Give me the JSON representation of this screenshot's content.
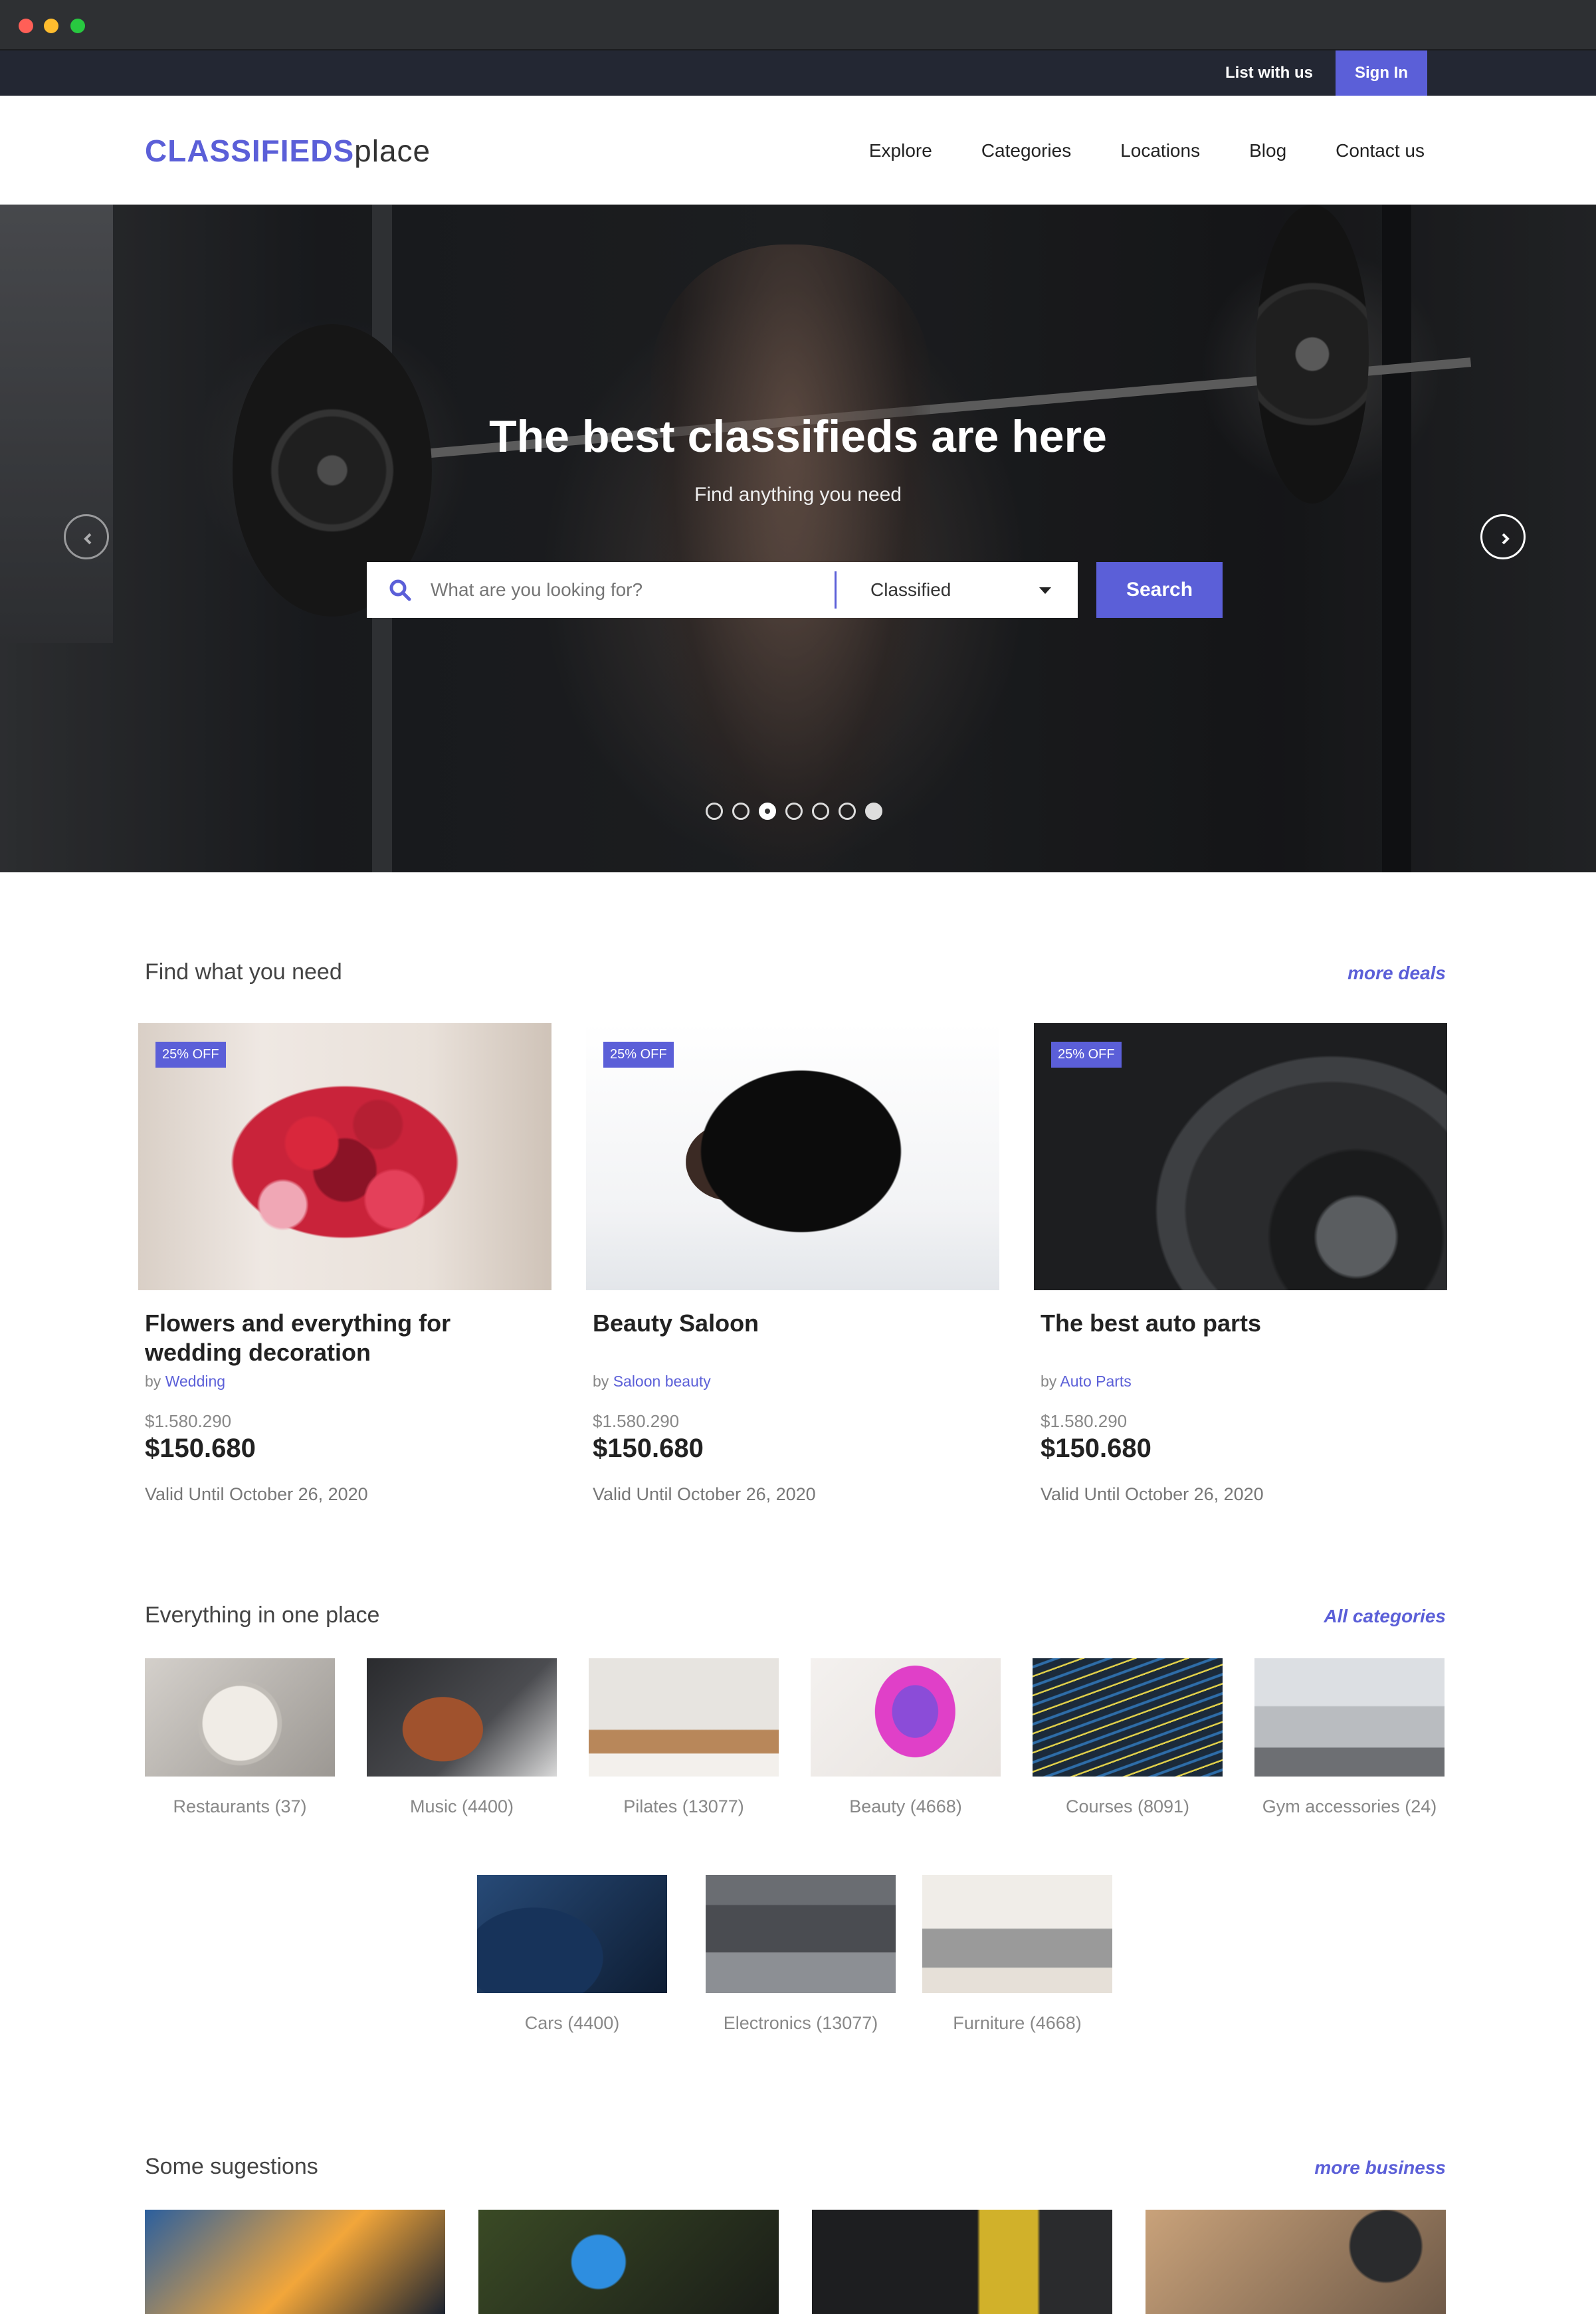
{
  "topbar": {
    "list_label": "List with us",
    "signin_label": "Sign In"
  },
  "header": {
    "logo_strong": "CLASSIFIEDS",
    "logo_light": "place",
    "nav": [
      "Explore",
      "Categories",
      "Locations",
      "Blog",
      "Contact us"
    ]
  },
  "hero": {
    "title": "The best classifieds are here",
    "subtitle": "Find anything you need",
    "search_placeholder": "What are you looking for?",
    "category_value": "Classified",
    "search_button": "Search",
    "carousel_active_index": 2,
    "carousel_count": 7
  },
  "deals_section": {
    "title": "Find what you need",
    "link": "more deals",
    "items": [
      {
        "badge": "25% OFF",
        "title": "Flowers and everything for wedding decoration",
        "by": "by",
        "by_link": "Wedding",
        "old_price": "$1.580.290",
        "price": "$150.680",
        "valid": "Valid Until October 26, 2020"
      },
      {
        "badge": "25% OFF",
        "title": "Beauty Saloon",
        "by": "by",
        "by_link": "Saloon beauty",
        "old_price": "$1.580.290",
        "price": "$150.680",
        "valid": "Valid Until October 26, 2020"
      },
      {
        "badge": "25% OFF",
        "title": "The best auto parts",
        "by": "by",
        "by_link": "Auto Parts",
        "old_price": "$1.580.290",
        "price": "$150.680",
        "valid": "Valid Until October 26, 2020"
      }
    ]
  },
  "categories_section": {
    "title": "Everything in one place",
    "link": "All categories",
    "items": [
      "Restaurants (37)",
      "Music (4400)",
      "Pilates (13077)",
      "Beauty (4668)",
      "Courses (8091)",
      "Gym accessories (24)",
      "Cars (4400)",
      "Electronics (13077)",
      "Furniture (4668)"
    ]
  },
  "suggestions_section": {
    "title": "Some sugestions",
    "link": "more business"
  },
  "colors": {
    "accent": "#5b5fd8",
    "topbar": "#232733"
  }
}
